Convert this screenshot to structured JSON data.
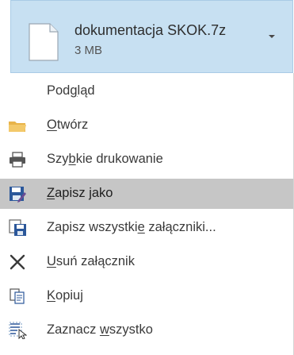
{
  "attachment": {
    "file_name": "dokumentacja SKOK.7z",
    "file_size": "3 MB",
    "icons": {
      "file": "file-icon",
      "dropdown": "chevron-down-icon"
    }
  },
  "menu": {
    "items": [
      {
        "id": "preview",
        "pre": "Pod",
        "key": "g",
        "post": "ląd",
        "icon": "none",
        "highlighted": false
      },
      {
        "id": "open",
        "pre": "",
        "key": "O",
        "post": "twórz",
        "icon": "folder-icon",
        "highlighted": false
      },
      {
        "id": "quick-print",
        "pre": "Szy",
        "key": "b",
        "post": "kie drukowanie",
        "icon": "printer-icon",
        "highlighted": false
      },
      {
        "id": "save-as",
        "pre": "",
        "key": "Z",
        "post": "apisz jako",
        "icon": "save-as-icon",
        "highlighted": true
      },
      {
        "id": "save-all",
        "pre": "Zapisz wszystki",
        "key": "e",
        "post": " załączniki...",
        "icon": "save-all-icon",
        "highlighted": false
      },
      {
        "id": "remove",
        "pre": "",
        "key": "U",
        "post": "suń załącznik",
        "icon": "close-icon",
        "highlighted": false
      },
      {
        "id": "copy",
        "pre": "",
        "key": "K",
        "post": "opiuj",
        "icon": "copy-icon",
        "highlighted": false
      },
      {
        "id": "select-all",
        "pre": "Zaznacz ",
        "key": "w",
        "post": "szystko",
        "icon": "select-all-icon",
        "highlighted": false
      }
    ]
  },
  "colors": {
    "attachment_bg": "#c7e0f2",
    "highlight": "#c6c6c6",
    "accent": "#2b579a"
  }
}
